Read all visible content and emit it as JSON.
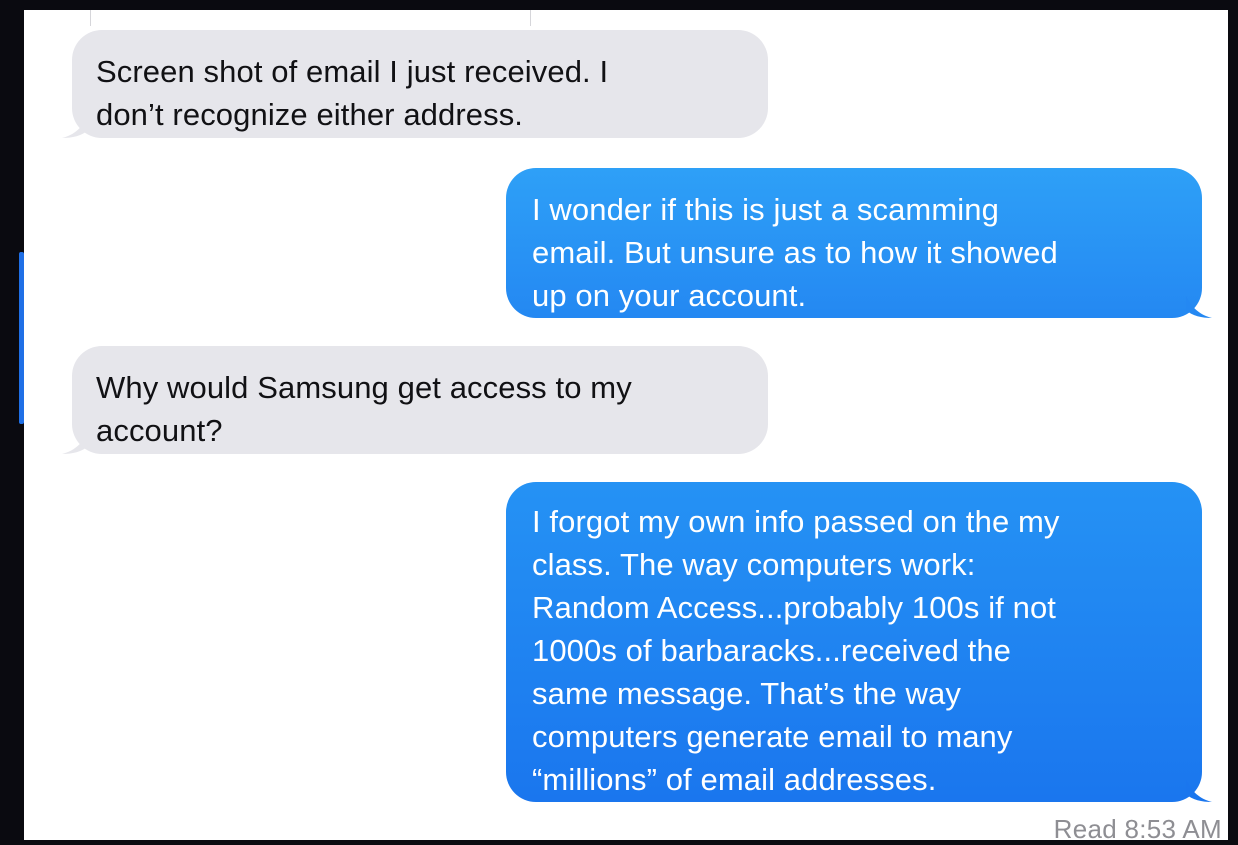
{
  "conversation": {
    "messages": [
      {
        "direction": "received",
        "text": "Screen shot of email I just received. I\ndon’t recognize either address."
      },
      {
        "direction": "sent",
        "text": "I wonder if this is just a scamming\nemail.  But unsure as to how it showed\nup on your account."
      },
      {
        "direction": "received",
        "text": "Why would Samsung get access to my\naccount?"
      },
      {
        "direction": "sent",
        "text": "I forgot my own info passed on the my\nclass.  The way computers work:\n Random Access...probably 100s if not\n1000s of barbaracks...received the\nsame message.  That’s the way\ncomputers generate email to many\n“millions” of email addresses."
      }
    ],
    "read_receipt": "Read 8:53 AM"
  },
  "colors": {
    "received_bubble": "#e6e6eb",
    "sent_bubble_top": "#2c9cf6",
    "sent_bubble_bottom": "#1a78f0",
    "background": "#ffffff",
    "frame": "#0a0a10",
    "accent": "#1f6fe6"
  }
}
